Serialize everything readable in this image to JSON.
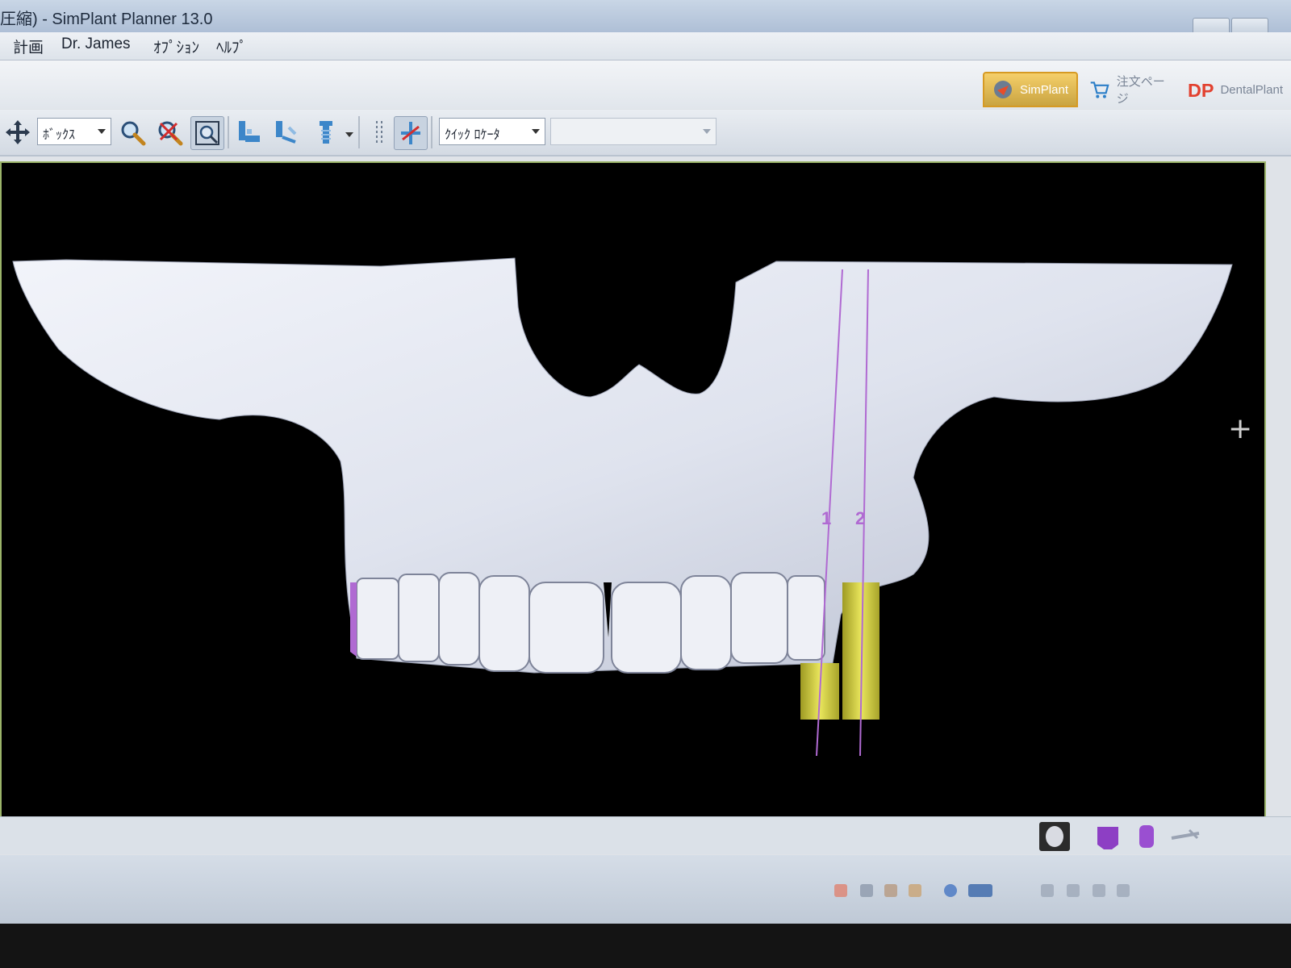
{
  "window": {
    "title": "圧縮) - SimPlant Planner  13.0"
  },
  "menubar": {
    "items": [
      "計画",
      "Dr. James",
      "ｵﾌﾟｼｮﾝ",
      "ﾍﾙﾌﾟ"
    ]
  },
  "app_switcher": {
    "tabs": [
      {
        "label": "SimPlant",
        "icon": "simplant-logo-icon",
        "active": true
      },
      {
        "label": "注文ページ",
        "icon": "cart-icon",
        "active": false
      },
      {
        "label": "DentalPlant",
        "icon": "dp-logo-icon",
        "active": false
      }
    ]
  },
  "toolbar": {
    "pan_icon": "move-icon",
    "selection_mode": "ﾎﾞｯｸｽ",
    "zoom_icon": "zoom-icon",
    "zoom_reset_icon": "zoom-cancel-icon",
    "fit_icon": "fit-view-icon",
    "quick_locator": "ｸｲｯｸ ﾛｹｰﾀ",
    "quick_locator_value": ""
  },
  "viewport": {
    "implants": [
      {
        "label": "1",
        "color": "#d8d44a"
      },
      {
        "label": "2",
        "color": "#d8d44a"
      }
    ],
    "bone_color": "#e6e9f2",
    "axis_color": "#b06ad2"
  },
  "view_strip": {
    "thumbs": [
      "bone-view-icon",
      "tooth-view-icon",
      "nerve-view-icon",
      "implant-view-icon"
    ]
  },
  "colors": {
    "accent": "#d69a23",
    "viewport_bg": "#000000",
    "implant": "#d8d44a",
    "marker": "#b06ad2"
  }
}
